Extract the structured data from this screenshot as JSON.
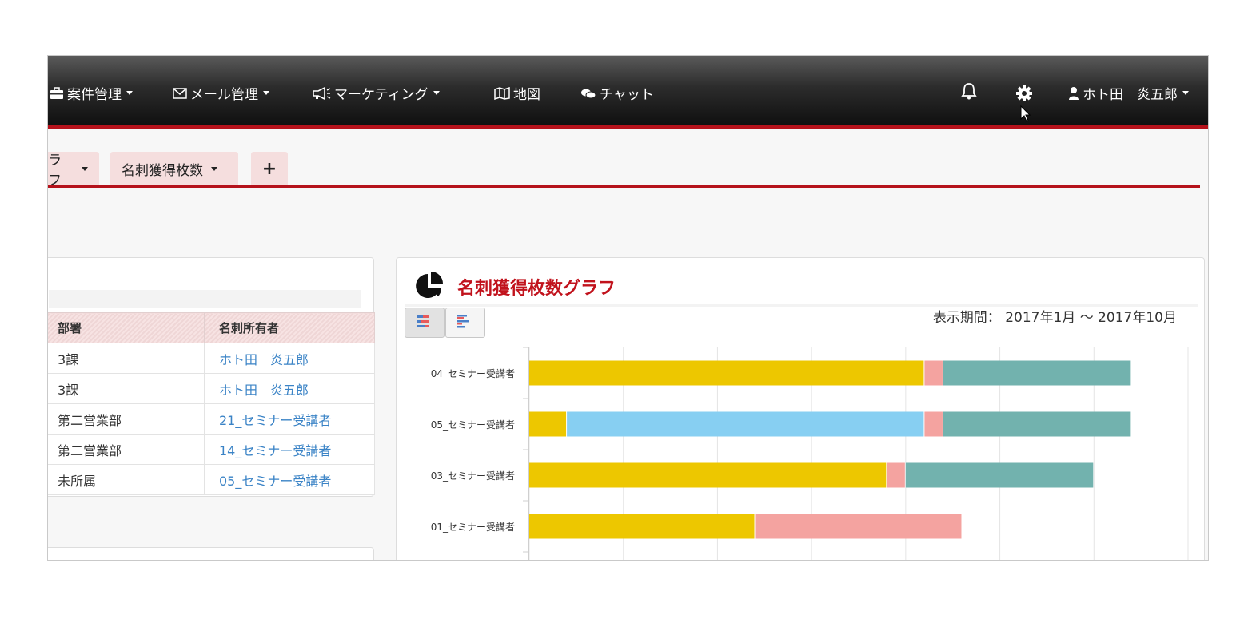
{
  "nav": {
    "items": [
      {
        "label": "案件管理",
        "icon": "briefcase-icon"
      },
      {
        "label": "メール管理",
        "icon": "envelope-icon"
      },
      {
        "label": "マーケティング",
        "icon": "megaphone-icon"
      },
      {
        "label": "地図",
        "icon": "map-icon"
      },
      {
        "label": "チャット",
        "icon": "chat-icon"
      }
    ],
    "user_name": "ホト田　炎五郎",
    "bell_icon": "bell-icon",
    "gear_icon": "gear-icon",
    "user_icon": "user-icon"
  },
  "tabs": [
    {
      "label": "ラフ"
    },
    {
      "label": "名刺獲得枚数"
    },
    {
      "label": "+"
    }
  ],
  "table": {
    "headers": [
      "部署",
      "名刺所有者"
    ],
    "rows": [
      [
        "3課",
        "ホト田　炎五郎"
      ],
      [
        "3課",
        "ホト田　炎五郎"
      ],
      [
        "第二営業部",
        "21_セミナー受講者"
      ],
      [
        "第二営業部",
        "14_セミナー受講者"
      ],
      [
        "未所属",
        "05_セミナー受講者"
      ]
    ]
  },
  "chart_panel": {
    "title": "名刺獲得枚数グラフ",
    "title_icon": "pie-chart-icon",
    "period": "表示期間： 2017年1月 ～ 2017年10月",
    "view_buttons": [
      "stacked-bar-icon",
      "grouped-bar-icon"
    ]
  },
  "colors": {
    "accent": "#b5121b",
    "link": "#3a83c6",
    "yellow": "#edc700",
    "pink": "#f4a3a0",
    "teal": "#72b2ae",
    "blue": "#87cff2"
  },
  "chart_data": {
    "type": "bar",
    "orientation": "horizontal",
    "stacked": true,
    "grid": true,
    "categories": [
      "04_セミナー受講者",
      "05_セミナー受講者",
      "03_セミナー受講者",
      "01_セミナー受講者"
    ],
    "series": [
      {
        "color": "#edc700",
        "values": [
          21,
          2,
          19,
          12
        ]
      },
      {
        "color": "#87cff2",
        "values": [
          0,
          19,
          0,
          0
        ]
      },
      {
        "color": "#f4a3a0",
        "values": [
          1,
          1,
          1,
          11
        ]
      },
      {
        "color": "#72b2ae",
        "values": [
          10,
          10,
          10,
          0
        ]
      }
    ],
    "xlim": [
      0,
      35
    ]
  }
}
